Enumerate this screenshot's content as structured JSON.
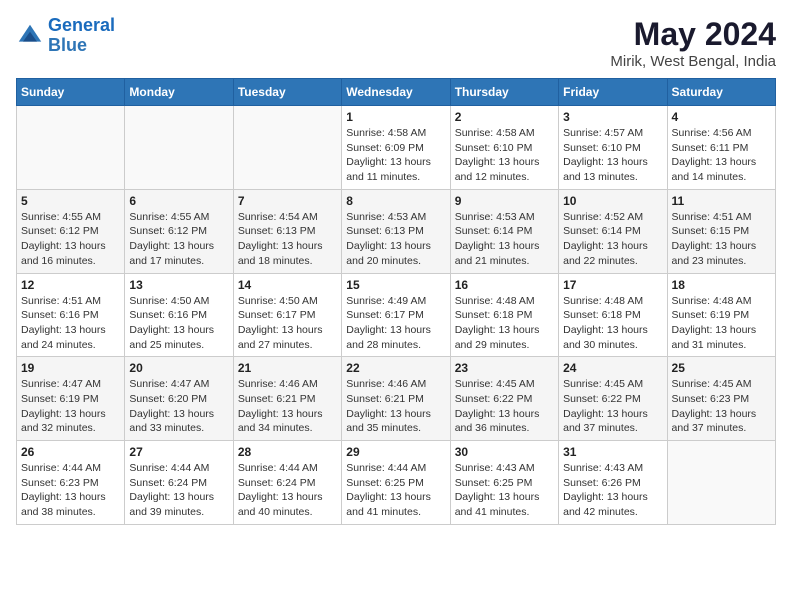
{
  "logo": {
    "line1": "General",
    "line2": "Blue"
  },
  "title": "May 2024",
  "subtitle": "Mirik, West Bengal, India",
  "weekdays": [
    "Sunday",
    "Monday",
    "Tuesday",
    "Wednesday",
    "Thursday",
    "Friday",
    "Saturday"
  ],
  "weeks": [
    [
      {
        "day": "",
        "info": ""
      },
      {
        "day": "",
        "info": ""
      },
      {
        "day": "",
        "info": ""
      },
      {
        "day": "1",
        "info": "Sunrise: 4:58 AM\nSunset: 6:09 PM\nDaylight: 13 hours\nand 11 minutes."
      },
      {
        "day": "2",
        "info": "Sunrise: 4:58 AM\nSunset: 6:10 PM\nDaylight: 13 hours\nand 12 minutes."
      },
      {
        "day": "3",
        "info": "Sunrise: 4:57 AM\nSunset: 6:10 PM\nDaylight: 13 hours\nand 13 minutes."
      },
      {
        "day": "4",
        "info": "Sunrise: 4:56 AM\nSunset: 6:11 PM\nDaylight: 13 hours\nand 14 minutes."
      }
    ],
    [
      {
        "day": "5",
        "info": "Sunrise: 4:55 AM\nSunset: 6:12 PM\nDaylight: 13 hours\nand 16 minutes."
      },
      {
        "day": "6",
        "info": "Sunrise: 4:55 AM\nSunset: 6:12 PM\nDaylight: 13 hours\nand 17 minutes."
      },
      {
        "day": "7",
        "info": "Sunrise: 4:54 AM\nSunset: 6:13 PM\nDaylight: 13 hours\nand 18 minutes."
      },
      {
        "day": "8",
        "info": "Sunrise: 4:53 AM\nSunset: 6:13 PM\nDaylight: 13 hours\nand 20 minutes."
      },
      {
        "day": "9",
        "info": "Sunrise: 4:53 AM\nSunset: 6:14 PM\nDaylight: 13 hours\nand 21 minutes."
      },
      {
        "day": "10",
        "info": "Sunrise: 4:52 AM\nSunset: 6:14 PM\nDaylight: 13 hours\nand 22 minutes."
      },
      {
        "day": "11",
        "info": "Sunrise: 4:51 AM\nSunset: 6:15 PM\nDaylight: 13 hours\nand 23 minutes."
      }
    ],
    [
      {
        "day": "12",
        "info": "Sunrise: 4:51 AM\nSunset: 6:16 PM\nDaylight: 13 hours\nand 24 minutes."
      },
      {
        "day": "13",
        "info": "Sunrise: 4:50 AM\nSunset: 6:16 PM\nDaylight: 13 hours\nand 25 minutes."
      },
      {
        "day": "14",
        "info": "Sunrise: 4:50 AM\nSunset: 6:17 PM\nDaylight: 13 hours\nand 27 minutes."
      },
      {
        "day": "15",
        "info": "Sunrise: 4:49 AM\nSunset: 6:17 PM\nDaylight: 13 hours\nand 28 minutes."
      },
      {
        "day": "16",
        "info": "Sunrise: 4:48 AM\nSunset: 6:18 PM\nDaylight: 13 hours\nand 29 minutes."
      },
      {
        "day": "17",
        "info": "Sunrise: 4:48 AM\nSunset: 6:18 PM\nDaylight: 13 hours\nand 30 minutes."
      },
      {
        "day": "18",
        "info": "Sunrise: 4:48 AM\nSunset: 6:19 PM\nDaylight: 13 hours\nand 31 minutes."
      }
    ],
    [
      {
        "day": "19",
        "info": "Sunrise: 4:47 AM\nSunset: 6:19 PM\nDaylight: 13 hours\nand 32 minutes."
      },
      {
        "day": "20",
        "info": "Sunrise: 4:47 AM\nSunset: 6:20 PM\nDaylight: 13 hours\nand 33 minutes."
      },
      {
        "day": "21",
        "info": "Sunrise: 4:46 AM\nSunset: 6:21 PM\nDaylight: 13 hours\nand 34 minutes."
      },
      {
        "day": "22",
        "info": "Sunrise: 4:46 AM\nSunset: 6:21 PM\nDaylight: 13 hours\nand 35 minutes."
      },
      {
        "day": "23",
        "info": "Sunrise: 4:45 AM\nSunset: 6:22 PM\nDaylight: 13 hours\nand 36 minutes."
      },
      {
        "day": "24",
        "info": "Sunrise: 4:45 AM\nSunset: 6:22 PM\nDaylight: 13 hours\nand 37 minutes."
      },
      {
        "day": "25",
        "info": "Sunrise: 4:45 AM\nSunset: 6:23 PM\nDaylight: 13 hours\nand 37 minutes."
      }
    ],
    [
      {
        "day": "26",
        "info": "Sunrise: 4:44 AM\nSunset: 6:23 PM\nDaylight: 13 hours\nand 38 minutes."
      },
      {
        "day": "27",
        "info": "Sunrise: 4:44 AM\nSunset: 6:24 PM\nDaylight: 13 hours\nand 39 minutes."
      },
      {
        "day": "28",
        "info": "Sunrise: 4:44 AM\nSunset: 6:24 PM\nDaylight: 13 hours\nand 40 minutes."
      },
      {
        "day": "29",
        "info": "Sunrise: 4:44 AM\nSunset: 6:25 PM\nDaylight: 13 hours\nand 41 minutes."
      },
      {
        "day": "30",
        "info": "Sunrise: 4:43 AM\nSunset: 6:25 PM\nDaylight: 13 hours\nand 41 minutes."
      },
      {
        "day": "31",
        "info": "Sunrise: 4:43 AM\nSunset: 6:26 PM\nDaylight: 13 hours\nand 42 minutes."
      },
      {
        "day": "",
        "info": ""
      }
    ]
  ]
}
